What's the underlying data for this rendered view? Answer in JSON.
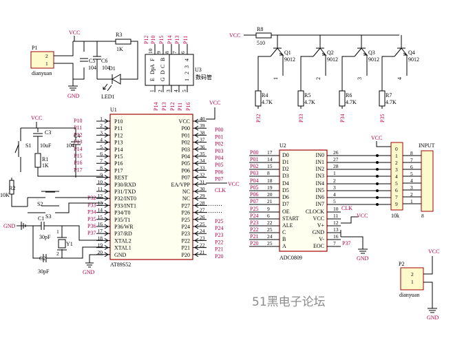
{
  "watermark": "51黑电子论坛",
  "power": {
    "vcc": "VCC",
    "gnd": "GND"
  },
  "p1": {
    "ref": "P1",
    "name": "dianyuan",
    "pins": [
      "2",
      "1"
    ]
  },
  "p2": {
    "ref": "P2",
    "name": "dianyuan",
    "pins": [
      "2",
      "1"
    ]
  },
  "r3": {
    "ref": "R3",
    "value": "1K"
  },
  "c5": {
    "ref": "C5",
    "value": "104"
  },
  "c6": {
    "ref": "C6",
    "value": "104"
  },
  "d1": {
    "ref": "D1"
  },
  "led1": {
    "ref": "LED1"
  },
  "u3": {
    "ref": "U3",
    "name": "数码管",
    "top_labels": [
      "P12",
      "P10",
      "P15",
      "P14",
      "P13",
      "P11"
    ],
    "top_pins": [
      "10",
      "9",
      "8",
      "7",
      "6"
    ],
    "bottom_labels": [
      "P14",
      "P13",
      "P12",
      "P11",
      "P16"
    ],
    "bottom_pins": [
      "1",
      "2",
      "3",
      "4",
      "5"
    ],
    "left_col": [
      "F",
      "A",
      "Dp",
      "E"
    ],
    "mid_col": [
      "B",
      "C",
      "D",
      "G"
    ],
    "right_col": [
      "4",
      "3",
      "2",
      "1"
    ]
  },
  "u1": {
    "ref": "U1",
    "name": "AT89S52",
    "left_pins": [
      {
        "num": "1",
        "name": "P10",
        "net": "P10"
      },
      {
        "num": "2",
        "name": "P11",
        "net": "P11"
      },
      {
        "num": "3",
        "name": "P12",
        "net": "P12"
      },
      {
        "num": "4",
        "name": "P13",
        "net": "P13"
      },
      {
        "num": "5",
        "name": "P14",
        "net": "P14"
      },
      {
        "num": "6",
        "name": "P15",
        "net": "P15"
      },
      {
        "num": "7",
        "name": "P16",
        "net": "P16"
      },
      {
        "num": "8",
        "name": "P17",
        "net": "P17"
      },
      {
        "num": "9",
        "name": "REST",
        "net": ""
      },
      {
        "num": "10",
        "name": "P30/RXD",
        "net": ""
      },
      {
        "num": "11",
        "name": "P31/TXD",
        "net": ""
      },
      {
        "num": "12",
        "name": "P32/INT0",
        "net": "P32"
      },
      {
        "num": "13",
        "name": "P33/INT1",
        "net": "P33"
      },
      {
        "num": "14",
        "name": "P34/T0",
        "net": "P34"
      },
      {
        "num": "15",
        "name": "P35/T1",
        "net": "P35"
      },
      {
        "num": "16",
        "name": "P36/WR",
        "net": "P36"
      },
      {
        "num": "17",
        "name": "P37/RD",
        "net": "P37"
      },
      {
        "num": "18",
        "name": "XTAL2",
        "net": ""
      },
      {
        "num": "19",
        "name": "XTAL1",
        "net": ""
      },
      {
        "num": "20",
        "name": "GND",
        "net": ""
      }
    ],
    "right_pins": [
      {
        "num": "40",
        "name": "VCC",
        "net": ""
      },
      {
        "num": "39",
        "name": "P00",
        "net": "P00"
      },
      {
        "num": "38",
        "name": "P01",
        "net": "P01"
      },
      {
        "num": "37",
        "name": "P02",
        "net": "P02"
      },
      {
        "num": "36",
        "name": "P03",
        "net": "P03"
      },
      {
        "num": "35",
        "name": "P04",
        "net": "P04"
      },
      {
        "num": "34",
        "name": "P05",
        "net": "P05"
      },
      {
        "num": "33",
        "name": "P06",
        "net": "P06"
      },
      {
        "num": "32",
        "name": "P07",
        "net": "P07"
      },
      {
        "num": "31",
        "name": "EA/VPP",
        "net": ""
      },
      {
        "num": "30",
        "name": "NC",
        "net": "CLK"
      },
      {
        "num": "29",
        "name": "NC",
        "net": ""
      },
      {
        "num": "28",
        "name": "P27",
        "net": ""
      },
      {
        "num": "27",
        "name": "P26",
        "net": ""
      },
      {
        "num": "26",
        "name": "P25",
        "net": "P25"
      },
      {
        "num": "25",
        "name": "P24",
        "net": "P24"
      },
      {
        "num": "24",
        "name": "P23",
        "net": "P23"
      },
      {
        "num": "23",
        "name": "P22",
        "net": "P22"
      },
      {
        "num": "22",
        "name": "P21",
        "net": "P21"
      },
      {
        "num": "21",
        "name": "P20",
        "net": "P20"
      }
    ]
  },
  "reset": {
    "s1": "S1",
    "c3": "C3",
    "c3_value": "10uF",
    "c4": "C4",
    "c4_value": "104",
    "r1": "R1",
    "r1_value": "1K",
    "r2": "R2",
    "r2_value": "10K",
    "s2": "S2",
    "s3": "S3"
  },
  "osc": {
    "c1": "C1",
    "c1_value": "30pF",
    "c2": "C2",
    "c2_value": "30pF",
    "y1": "Y1",
    "nums": [
      "1",
      "2"
    ]
  },
  "drivers": {
    "r8": "R8",
    "r8_value": "510",
    "transistors": [
      {
        "ref": "Q1",
        "type": "9012",
        "num": "1",
        "r": "R4",
        "rv": "4.7K",
        "net": "P32"
      },
      {
        "ref": "Q2",
        "type": "9012",
        "num": "2",
        "r": "R5",
        "rv": "4.7K",
        "net": "P33"
      },
      {
        "ref": "Q3",
        "type": "9012",
        "num": "3",
        "r": "R6",
        "rv": "4.7K",
        "net": "P34"
      },
      {
        "ref": "Q4",
        "type": "9012",
        "num": "4",
        "r": "R7",
        "rv": "4.7K",
        "net": "P35"
      }
    ]
  },
  "u2": {
    "ref": "U2",
    "name": "ADC0809",
    "left_pins": [
      {
        "net": "P00",
        "num": "17",
        "name": "D0"
      },
      {
        "net": "P01",
        "num": "14",
        "name": "D1"
      },
      {
        "net": "P02",
        "num": "15",
        "name": "D2"
      },
      {
        "net": "P03",
        "num": "8",
        "name": "D3"
      },
      {
        "net": "P04",
        "num": "18",
        "name": "D4"
      },
      {
        "net": "P05",
        "num": "19",
        "name": "D5"
      },
      {
        "net": "P06",
        "num": "20",
        "name": "D6"
      },
      {
        "net": "P07",
        "num": "21",
        "name": "D7"
      },
      {
        "net": "P25",
        "num": "9",
        "name": "OE"
      },
      {
        "net": "P24",
        "num": "6",
        "name": "START"
      },
      {
        "net": "P23",
        "num": "22",
        "name": "ALE"
      },
      {
        "net": "P22",
        "num": "25",
        "name": "C"
      },
      {
        "net": "P21",
        "num": "24",
        "name": "B"
      },
      {
        "net": "P20",
        "num": "25",
        "name": "A"
      }
    ],
    "right_pins": [
      {
        "name": "IN0",
        "num": "26"
      },
      {
        "name": "IN1",
        "num": "27"
      },
      {
        "name": "IN2",
        "num": "28"
      },
      {
        "name": "IN3",
        "num": "1"
      },
      {
        "name": "IN4",
        "num": "2"
      },
      {
        "name": "IN5",
        "num": "3"
      },
      {
        "name": "IN6",
        "num": "4"
      },
      {
        "name": "IN7",
        "num": "5"
      },
      {
        "name": "CLOCK",
        "num": "10"
      },
      {
        "name": "VCC",
        "num": "11"
      },
      {
        "name": "V+",
        "num": "12"
      },
      {
        "name": "GND",
        "num": "13"
      },
      {
        "name": "V-",
        "num": "16"
      },
      {
        "name": "EOC",
        "num": "7"
      }
    ],
    "clk_net": "CLK",
    "eoc_net": "P37"
  },
  "rpack": {
    "value": "10k",
    "left_nums": [
      "0",
      "1",
      "2",
      "3",
      "4",
      "5",
      "6",
      "7",
      "9"
    ]
  },
  "input": {
    "label": "INPUT",
    "nums": [
      "8",
      "7",
      "6",
      "5",
      "4",
      "3",
      "2",
      "1"
    ],
    "bottom": "8"
  }
}
